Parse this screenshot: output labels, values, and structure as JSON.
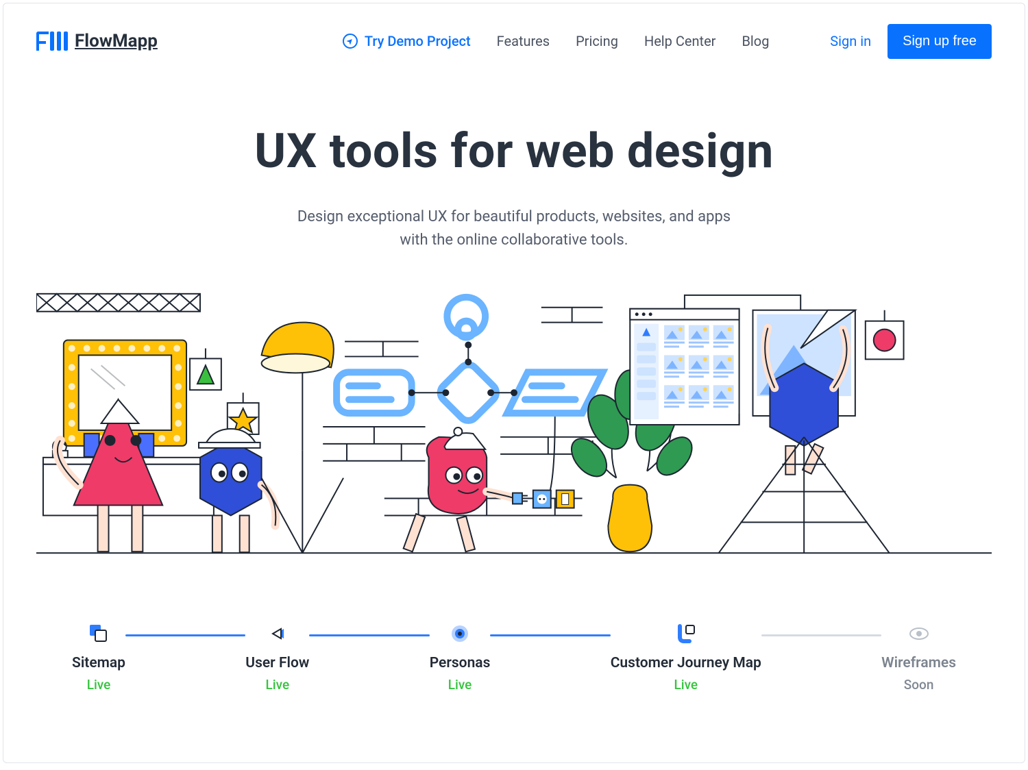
{
  "brand": {
    "name": "FlowMapp"
  },
  "nav": {
    "demo": "Try Demo Project",
    "features": "Features",
    "pricing": "Pricing",
    "help": "Help Center",
    "blog": "Blog"
  },
  "auth": {
    "signin": "Sign in",
    "signup": "Sign up free"
  },
  "hero": {
    "title": "UX tools for web design",
    "subtitle_line1": "Design exceptional UX for beautiful products, websites, and apps",
    "subtitle_line2": "with the online collaborative tools."
  },
  "features": [
    {
      "label": "Sitemap",
      "status": "Live",
      "status_kind": "live",
      "icon": "sitemap"
    },
    {
      "label": "User Flow",
      "status": "Live",
      "status_kind": "live",
      "icon": "userflow"
    },
    {
      "label": "Personas",
      "status": "Live",
      "status_kind": "live",
      "icon": "personas"
    },
    {
      "label": "Customer Journey Map",
      "status": "Live",
      "status_kind": "live",
      "icon": "cjm"
    },
    {
      "label": "Wireframes",
      "status": "Soon",
      "status_kind": "soon",
      "icon": "wireframes"
    }
  ],
  "colors": {
    "primary": "#0872ff",
    "text": "#2a3341",
    "live": "#36c33e",
    "soon": "#808893"
  }
}
